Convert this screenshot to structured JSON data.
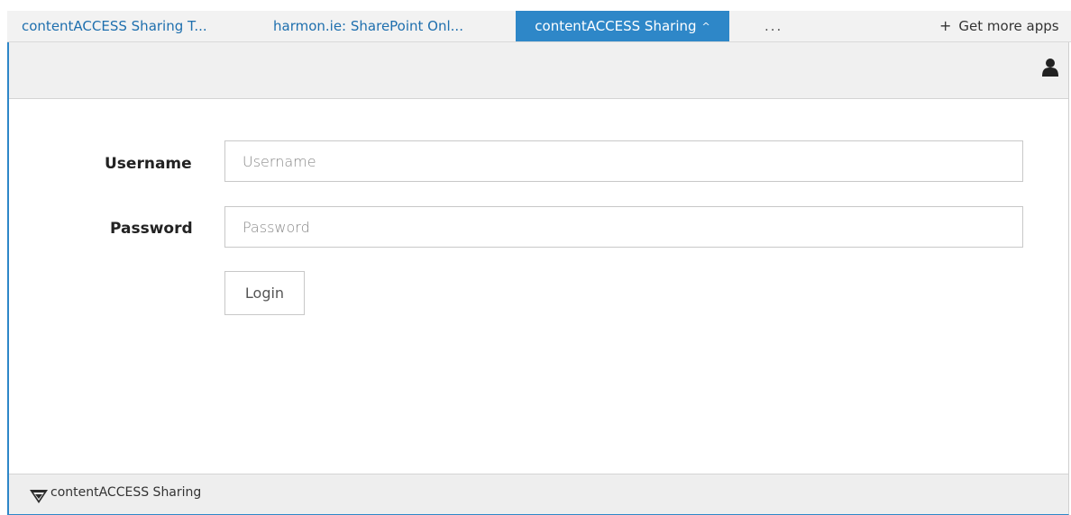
{
  "tabs": [
    {
      "label": "contentACCESS Sharing T..."
    },
    {
      "label": "harmon.ie: SharePoint Onl..."
    },
    {
      "label": "contentACCESS Sharing",
      "caret": "^"
    },
    {
      "label": "..."
    },
    {
      "label": "Get more apps",
      "prefix": "+"
    }
  ],
  "form": {
    "username_label": "Username",
    "username_placeholder": "Username",
    "password_label": "Password",
    "password_placeholder": "Password",
    "login_label": "Login"
  },
  "footer": {
    "text": "contentACCESS Sharing",
    "logo_icon": "contentaccess-logo-icon"
  },
  "icons": {
    "user": "user-icon"
  },
  "colors": {
    "accent": "#2e87c8",
    "tab_text": "#1e6fae"
  }
}
